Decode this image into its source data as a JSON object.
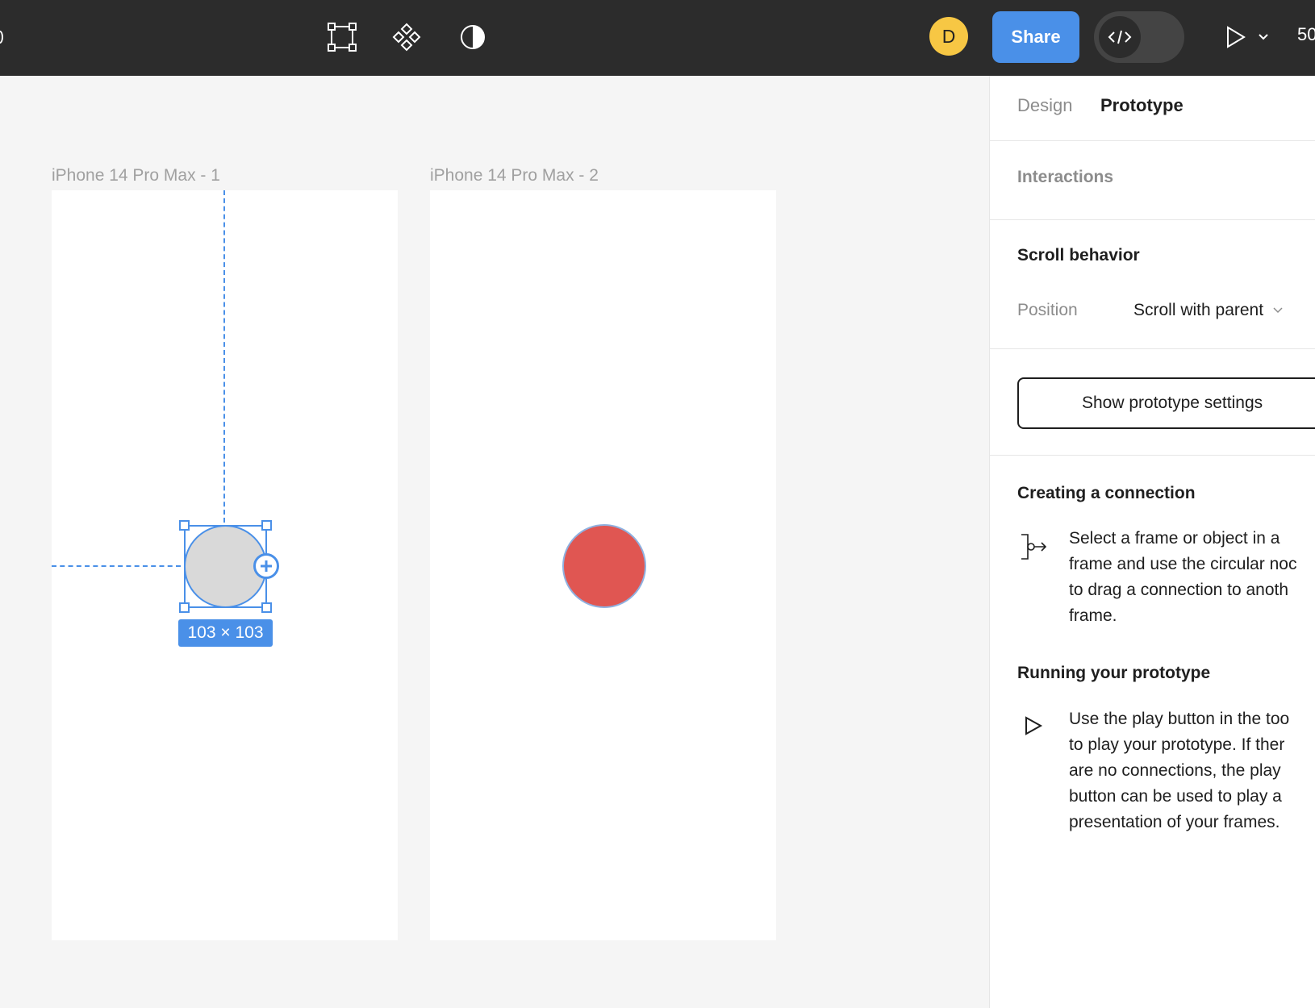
{
  "toolbar": {
    "tools": [
      {
        "icon": "frame-tool-icon"
      },
      {
        "icon": "components-icon"
      },
      {
        "icon": "contrast-icon"
      }
    ],
    "avatar_initial": "D",
    "share_label": "Share",
    "dev_mode_icon": "code-icon",
    "play_icon": "play-icon",
    "zoom": "50"
  },
  "canvas": {
    "frames": [
      {
        "label": "iPhone 14 Pro Max - 1"
      },
      {
        "label": "iPhone 14 Pro Max - 2"
      }
    ],
    "selection_size": "103 × 103",
    "colors": {
      "selection": "#4A90E8",
      "ellipse_gray": "#D9D9D9",
      "ellipse_red": "#E05652"
    }
  },
  "panel": {
    "tabs": [
      {
        "label": "Design",
        "active": false
      },
      {
        "label": "Prototype",
        "active": true
      }
    ],
    "interactions_title": "Interactions",
    "scroll_behavior": {
      "title": "Scroll behavior",
      "position_label": "Position",
      "position_value": "Scroll with parent"
    },
    "prototype_settings_button": "Show prototype settings",
    "help": [
      {
        "title": "Creating a connection",
        "icon": "connection-icon",
        "text": "Select a frame or object in a\nframe and use the circular noc\nto drag a connection to anoth\nframe."
      },
      {
        "title": "Running your prototype",
        "icon": "play-outline-icon",
        "text": "Use the play button in the too\nto play your prototype. If ther\nare no connections, the play\nbutton can be used to play a\npresentation of your frames."
      }
    ]
  }
}
